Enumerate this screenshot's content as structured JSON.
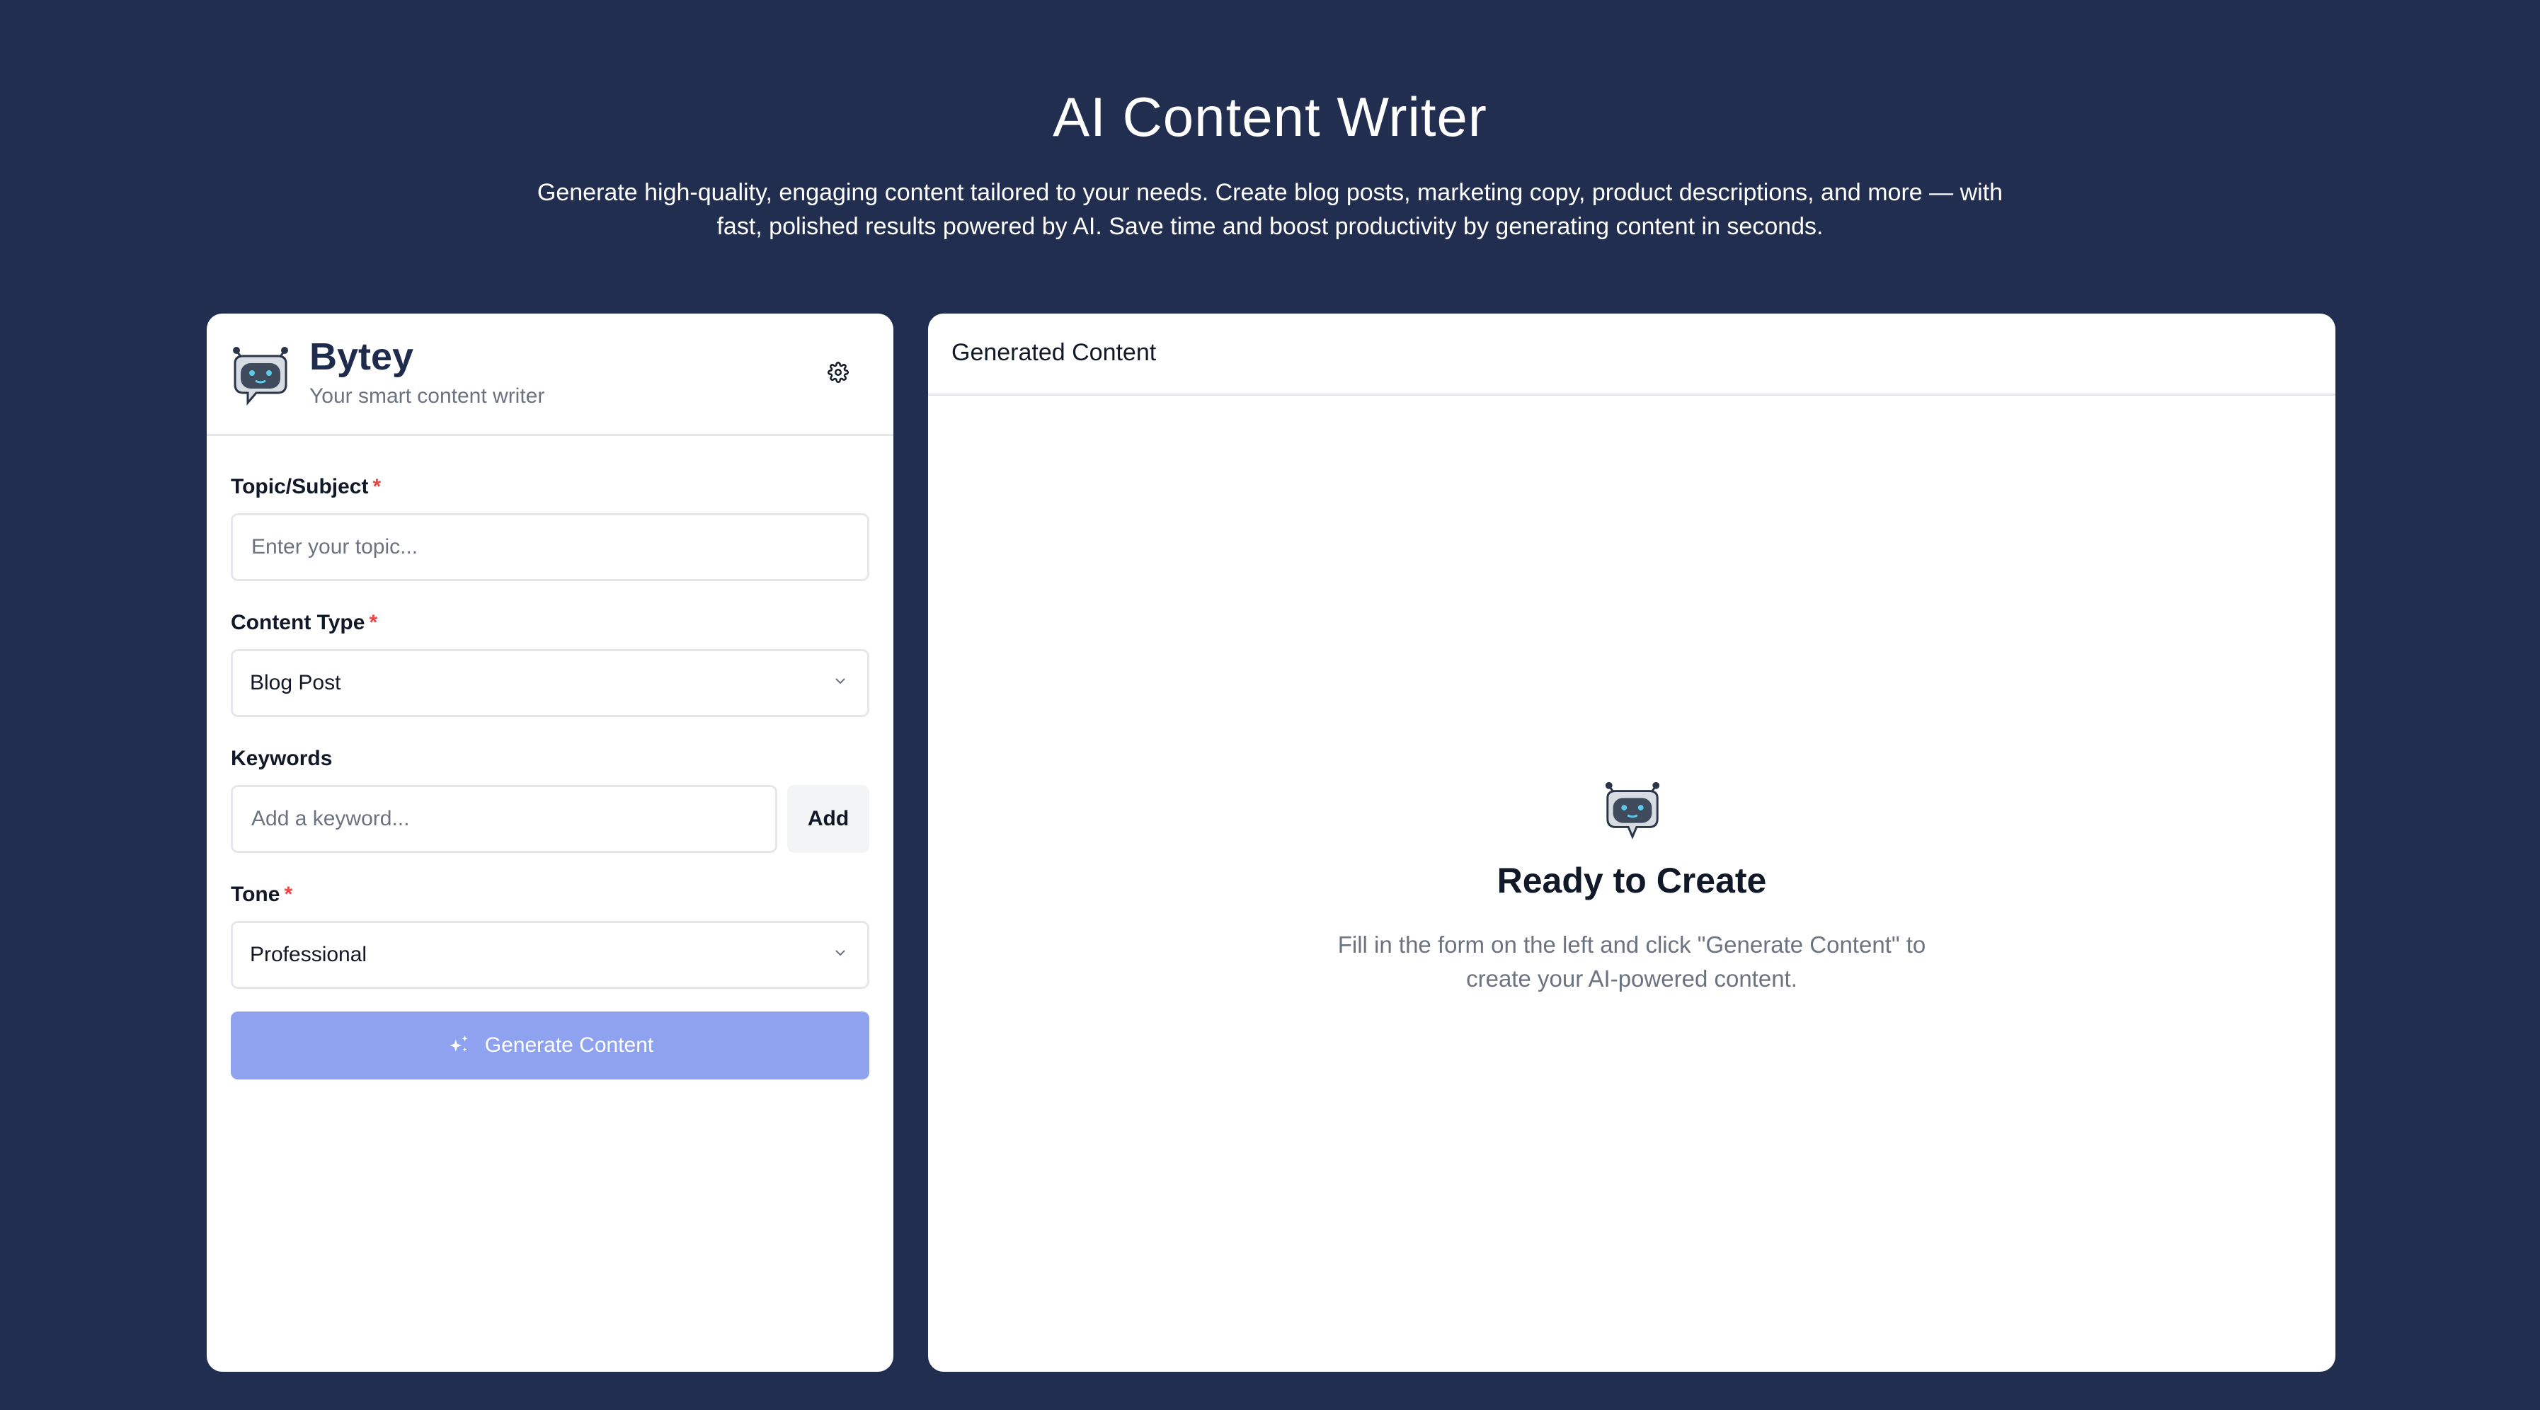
{
  "hero": {
    "title": "AI Content Writer",
    "description": "Generate high-quality, engaging content tailored to your needs. Create blog posts, marketing copy, product descriptions, and more — with fast, polished results powered by AI. Save time and boost productivity by generating content in seconds."
  },
  "brand": {
    "name": "Bytey",
    "tagline": "Your smart content writer",
    "logo_icon": "robot-chat-icon",
    "settings_icon": "gear-icon"
  },
  "form": {
    "topic": {
      "label": "Topic/Subject",
      "required_mark": "*",
      "placeholder": "Enter your topic...",
      "value": ""
    },
    "content_type": {
      "label": "Content Type",
      "required_mark": "*",
      "selected": "Blog Post"
    },
    "keywords": {
      "label": "Keywords",
      "placeholder": "Add a keyword...",
      "add_label": "Add"
    },
    "tone": {
      "label": "Tone",
      "required_mark": "*",
      "selected": "Professional"
    },
    "generate_label": "Generate Content",
    "generate_icon": "sparkles-icon"
  },
  "output": {
    "title": "Generated Content",
    "empty_title": "Ready to Create",
    "empty_description": "Fill in the form on the left and click \"Generate Content\" to create your AI-powered content."
  },
  "colors": {
    "background": "#212e4f",
    "brand": "#1e2b4d",
    "button_disabled": "#8ea2f0",
    "required": "#ef4444"
  }
}
